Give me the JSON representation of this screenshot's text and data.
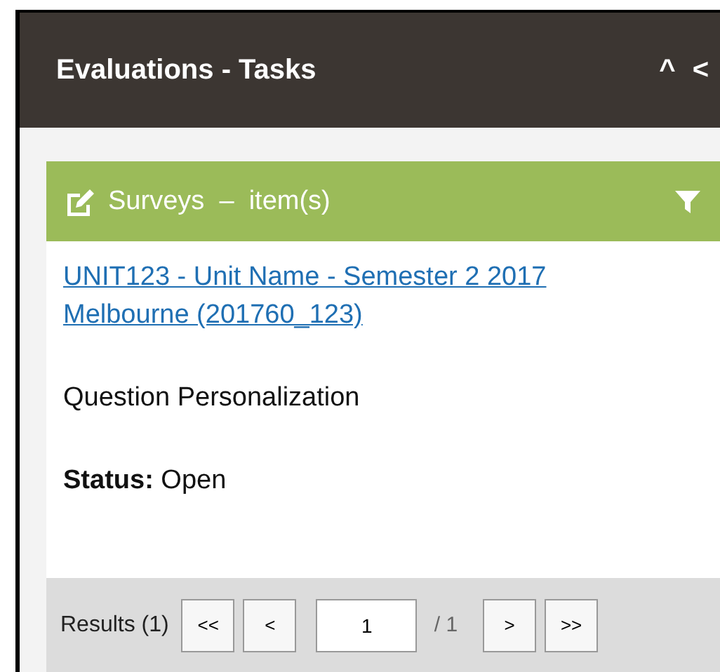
{
  "panel": {
    "title": "Evaluations - Tasks",
    "controls": [
      "^",
      "<"
    ]
  },
  "section": {
    "title": "Surveys  –  item(s)"
  },
  "item": {
    "link": "UNIT123 - Unit Name - Semester 2 2017 Melbourne (201760_123)",
    "description": "Question Personalization",
    "status": "**Status:** Open"
  },
  "pager": {
    "results": "Results (1)",
    "first": "<<",
    "prev": "<",
    "page": "1",
    "total": "/ 1",
    "next": ">",
    "last": ">>"
  }
}
